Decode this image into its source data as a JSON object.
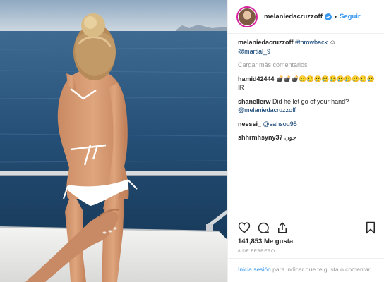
{
  "post": {
    "username": "melaniedacruzzoff",
    "follow_label": "Seguir",
    "separator": "•",
    "caption_user": "melaniedacruzzoff",
    "caption_tag": "#throwback",
    "caption_emoji": "☺",
    "caption_mention": "@martial_9",
    "load_more": "Cargar más comentarios",
    "comments": [
      {
        "user": "hamid42444",
        "text": "💣💣💣😢😢😢😢😢😢😢😢😢😢IR"
      },
      {
        "user": "shanellerw",
        "text": "Did he let go of your hand?",
        "mention": "@melaniedacruzzoff"
      },
      {
        "user": "neessi_",
        "mention": "@sahsou95"
      },
      {
        "user": "shhrmhsyny37",
        "text": "جون"
      }
    ],
    "likes": "141,853 Me gusta",
    "date": "8 DE FEBRERO",
    "login_link": "Inicia sesión",
    "login_text": "para indicar que te gusta o comentar."
  },
  "icons": {
    "like": "heart-icon",
    "comment": "comment-icon",
    "share": "share-icon",
    "save": "bookmark-icon",
    "verified": "verified-badge-icon"
  },
  "colors": {
    "link": "#003569",
    "accent": "#3897f0",
    "muted": "#999999",
    "sea": "#21486b",
    "sky": "#a9c1d6"
  }
}
